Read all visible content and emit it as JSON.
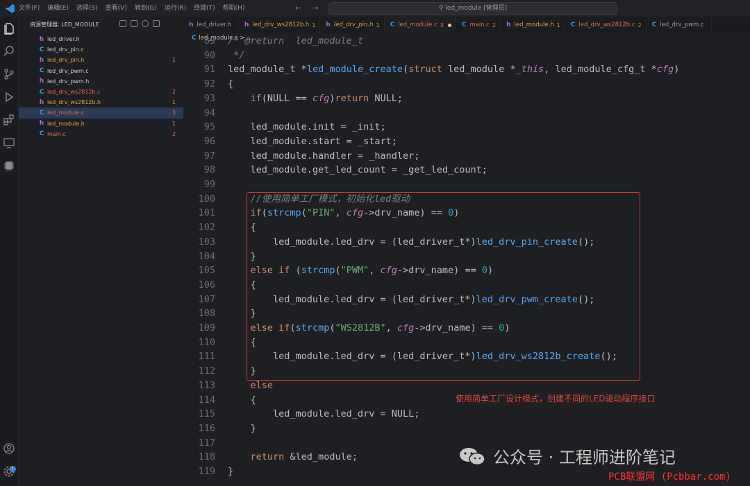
{
  "window": {
    "menu": [
      "文件(F)",
      "编辑(E)",
      "选择(S)",
      "查看(V)",
      "转到(G)",
      "运行(R)",
      "终端(T)",
      "帮助(H)"
    ],
    "nav_back": "←",
    "nav_forward": "→",
    "command_center": "led_module [管理员]"
  },
  "explorer": {
    "title": "资源管理器: LED_MODULE",
    "files": [
      {
        "icon": "h",
        "name": "led_driver.h",
        "count": "",
        "color": "#cfcfcf"
      },
      {
        "icon": "c",
        "name": "led_drv_pin.c",
        "count": "",
        "color": "#cfcfcf"
      },
      {
        "icon": "h",
        "name": "led_drv_pin.h",
        "count": "1",
        "color": "#d9a443"
      },
      {
        "icon": "c",
        "name": "led_drv_pwm.c",
        "count": "",
        "color": "#cfcfcf"
      },
      {
        "icon": "h",
        "name": "led_drv_pwm.h",
        "count": "",
        "color": "#cfcfcf"
      },
      {
        "icon": "c",
        "name": "led_drv_ws2812b.c",
        "count": "2",
        "color": "#e06c5a"
      },
      {
        "icon": "h",
        "name": "led_drv_ws2812b.h",
        "count": "1",
        "color": "#d9a443"
      },
      {
        "icon": "c",
        "name": "led_module.c",
        "count": "3",
        "color": "#e06c5a",
        "active": true
      },
      {
        "icon": "h",
        "name": "led_module.h",
        "count": "1",
        "color": "#d9a443"
      },
      {
        "icon": "c",
        "name": "main.c",
        "count": "2",
        "color": "#e06c5a"
      }
    ]
  },
  "tabs": [
    {
      "icon": "h",
      "label": "led_driver.h",
      "count": "",
      "color": "#9a9a9a"
    },
    {
      "icon": "h",
      "label": "led_drv_ws2812b.h",
      "count": "1",
      "color": "#d9a443"
    },
    {
      "icon": "h",
      "label": "led_drv_pin.h",
      "count": "1",
      "color": "#d9a443",
      "italic": true
    },
    {
      "icon": "c",
      "label": "led_module.c",
      "count": "3",
      "color": "#e06c5a",
      "active": true
    },
    {
      "icon": "c",
      "label": "main.c",
      "count": "2",
      "color": "#e06c5a"
    },
    {
      "icon": "h",
      "label": "led_module.h",
      "count": "1",
      "color": "#d9a443"
    },
    {
      "icon": "c",
      "label": "led_drv_ws2812b.c",
      "count": "2",
      "color": "#e06c5a"
    },
    {
      "icon": "c",
      "label": "led_drv_pwm.c",
      "count": "",
      "color": "#9a9a9a"
    }
  ],
  "breadcrumb": {
    "file": "led_module.c",
    "sep": " > ..."
  },
  "code": [
    {
      "n": "89",
      "t": [
        [
          "cmt",
          "/* @return  led_module_t"
        ]
      ]
    },
    {
      "n": "90",
      "t": [
        [
          "cmt",
          " */"
        ]
      ]
    },
    {
      "n": "91",
      "t": [
        [
          "ty",
          "led_module_t "
        ],
        [
          "plain",
          "*"
        ],
        [
          "fn",
          "led_module_create"
        ],
        [
          "plain",
          "("
        ],
        [
          "kw",
          "struct "
        ],
        [
          "ty",
          "led_module "
        ],
        [
          "plain",
          "*"
        ],
        [
          "var",
          "_this"
        ],
        [
          "plain",
          ", "
        ],
        [
          "ty",
          "led_module_cfg_t "
        ],
        [
          "plain",
          "*"
        ],
        [
          "var",
          "cfg"
        ],
        [
          "plain",
          ")"
        ]
      ]
    },
    {
      "n": "92",
      "t": [
        [
          "plain",
          "{"
        ]
      ]
    },
    {
      "n": "93",
      "t": [
        [
          "plain",
          "    "
        ],
        [
          "kw",
          "if"
        ],
        [
          "plain",
          "(NULL == "
        ],
        [
          "var",
          "cfg"
        ],
        [
          "plain",
          ")"
        ],
        [
          "kw",
          "return "
        ],
        [
          "plain",
          "NULL;"
        ]
      ]
    },
    {
      "n": "94",
      "t": []
    },
    {
      "n": "95",
      "t": [
        [
          "plain",
          "    led_module.init = _init;"
        ]
      ]
    },
    {
      "n": "96",
      "t": [
        [
          "plain",
          "    led_module.start = _start;"
        ]
      ]
    },
    {
      "n": "97",
      "t": [
        [
          "plain",
          "    led_module.handler = _handler;"
        ]
      ]
    },
    {
      "n": "98",
      "t": [
        [
          "plain",
          "    led_module.get_led_count = _get_led_count;"
        ]
      ]
    },
    {
      "n": "99",
      "t": []
    },
    {
      "n": "100",
      "t": [
        [
          "plain",
          "    "
        ],
        [
          "cmt",
          "//使用简单工厂模式，初始化led驱动"
        ]
      ]
    },
    {
      "n": "101",
      "t": [
        [
          "plain",
          "    "
        ],
        [
          "kw",
          "if"
        ],
        [
          "plain",
          "("
        ],
        [
          "fn",
          "strcmp"
        ],
        [
          "plain",
          "("
        ],
        [
          "str",
          "\"PIN\""
        ],
        [
          "plain",
          ", "
        ],
        [
          "var",
          "cfg"
        ],
        [
          "plain",
          "->drv_name) == "
        ],
        [
          "num",
          "0"
        ],
        [
          "plain",
          ")"
        ]
      ]
    },
    {
      "n": "102",
      "t": [
        [
          "plain",
          "    {"
        ]
      ]
    },
    {
      "n": "103",
      "t": [
        [
          "plain",
          "        led_module.led_drv = (led_driver_t*)"
        ],
        [
          "fn",
          "led_drv_pin_create"
        ],
        [
          "plain",
          "();"
        ]
      ]
    },
    {
      "n": "104",
      "t": [
        [
          "plain",
          "    }"
        ]
      ]
    },
    {
      "n": "105",
      "t": [
        [
          "plain",
          "    "
        ],
        [
          "kw",
          "else if "
        ],
        [
          "plain",
          "("
        ],
        [
          "fn",
          "strcmp"
        ],
        [
          "plain",
          "("
        ],
        [
          "str",
          "\"PWM\""
        ],
        [
          "plain",
          ", "
        ],
        [
          "var",
          "cfg"
        ],
        [
          "plain",
          "->drv_name) == "
        ],
        [
          "num",
          "0"
        ],
        [
          "plain",
          ")"
        ]
      ]
    },
    {
      "n": "106",
      "t": [
        [
          "plain",
          "    {"
        ]
      ]
    },
    {
      "n": "107",
      "t": [
        [
          "plain",
          "        led_module.led_drv = (led_driver_t*)"
        ],
        [
          "fn",
          "led_drv_pwm_create"
        ],
        [
          "plain",
          "();"
        ]
      ]
    },
    {
      "n": "108",
      "t": [
        [
          "plain",
          "    }"
        ]
      ]
    },
    {
      "n": "109",
      "t": [
        [
          "plain",
          "    "
        ],
        [
          "kw",
          "else if"
        ],
        [
          "plain",
          "("
        ],
        [
          "fn",
          "strcmp"
        ],
        [
          "plain",
          "("
        ],
        [
          "str",
          "\"WS2812B\""
        ],
        [
          "plain",
          ", "
        ],
        [
          "var",
          "cfg"
        ],
        [
          "plain",
          "->drv_name) == "
        ],
        [
          "num",
          "0"
        ],
        [
          "plain",
          ")"
        ]
      ]
    },
    {
      "n": "110",
      "t": [
        [
          "plain",
          "    {"
        ]
      ]
    },
    {
      "n": "111",
      "t": [
        [
          "plain",
          "        led_module.led_drv = (led_driver_t*)"
        ],
        [
          "fn",
          "led_drv_ws2812b_create"
        ],
        [
          "plain",
          "();"
        ]
      ]
    },
    {
      "n": "112",
      "t": [
        [
          "plain",
          "    }"
        ]
      ]
    },
    {
      "n": "113",
      "t": [
        [
          "plain",
          "    "
        ],
        [
          "kw",
          "else"
        ]
      ]
    },
    {
      "n": "114",
      "t": [
        [
          "plain",
          "    {"
        ]
      ]
    },
    {
      "n": "115",
      "t": [
        [
          "plain",
          "        led_module.led_drv = NULL;"
        ]
      ]
    },
    {
      "n": "116",
      "t": [
        [
          "plain",
          "    }"
        ]
      ]
    },
    {
      "n": "117",
      "t": []
    },
    {
      "n": "118",
      "t": [
        [
          "plain",
          "    "
        ],
        [
          "kw",
          "return "
        ],
        [
          "plain",
          "&led_module;"
        ]
      ]
    },
    {
      "n": "119",
      "t": [
        [
          "plain",
          "}"
        ]
      ]
    }
  ],
  "annotation": "使用简单工厂设计模式，创建不同的LED驱动程序接口",
  "watermark": {
    "account": "公众号 · 工程师进阶笔记",
    "site": "PCB联盟网 (Pcbbar.com)"
  },
  "badge_count": "1",
  "colors": {
    "accent": "#2f7fd6",
    "highlight": "#d53a3a"
  }
}
